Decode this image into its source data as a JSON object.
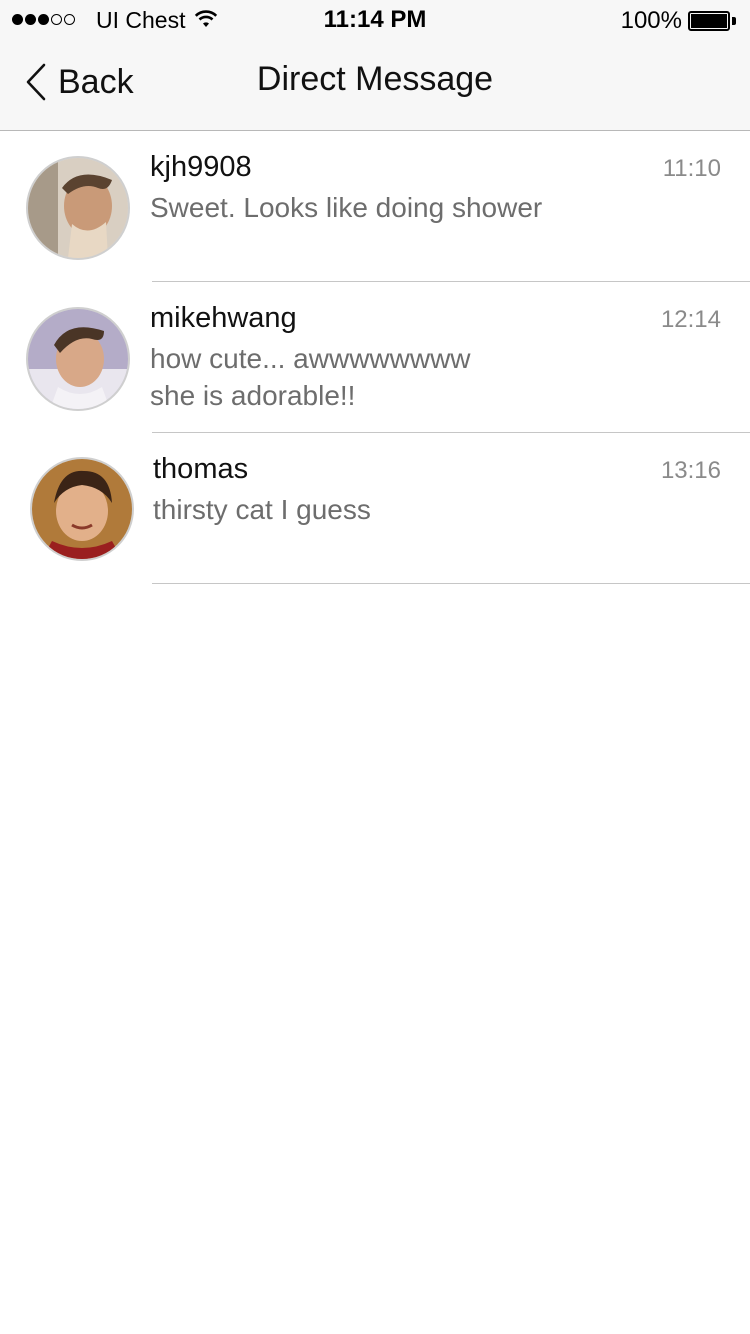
{
  "status_bar": {
    "signal_bars_filled": 3,
    "signal_bars_total": 5,
    "carrier": "UI Chest",
    "time": "11:14 PM",
    "battery": "100%"
  },
  "nav": {
    "back_label": "Back",
    "title": "Direct Message"
  },
  "messages": [
    {
      "username": "kjh9908",
      "time": "11:10",
      "lines": [
        "Sweet. Looks like doing shower"
      ]
    },
    {
      "username": "mikehwang",
      "time": "12:14",
      "lines": [
        "how cute... awwwwwwww",
        "she is adorable!!"
      ]
    },
    {
      "username": "thomas",
      "time": "13:16",
      "lines": [
        "thirsty cat I guess"
      ]
    }
  ],
  "colors": {
    "bar_background": "#f7f7f7",
    "divider": "#c6c6c6",
    "secondary_text": "#6d6d6d",
    "time_text": "#8a8a8a"
  }
}
